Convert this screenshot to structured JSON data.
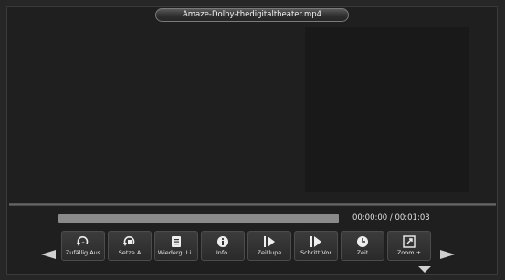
{
  "window": {
    "title": "Amaze-Dolby-thedigitaltheater.mp4"
  },
  "playback": {
    "position": "00:00:00",
    "separator": "/",
    "duration": "00:01:03",
    "progress_fraction": 0
  },
  "controls": [
    {
      "label": "Zufällig Aus",
      "icon": "shuffle-off-icon"
    },
    {
      "label": "Setze A",
      "icon": "repeat-ab-icon"
    },
    {
      "label": "Wiederg. Li..",
      "icon": "playlist-icon"
    },
    {
      "label": "Info.",
      "icon": "info-icon"
    },
    {
      "label": "Zeitlupe",
      "icon": "slow-motion-icon"
    },
    {
      "label": "Schritt Vor",
      "icon": "step-forward-icon"
    },
    {
      "label": "Zeit",
      "icon": "clock-icon"
    },
    {
      "label": "Zoom +",
      "icon": "zoom-in-icon"
    }
  ],
  "colors": {
    "background": "#262626",
    "accent": "#d8d8d8"
  }
}
